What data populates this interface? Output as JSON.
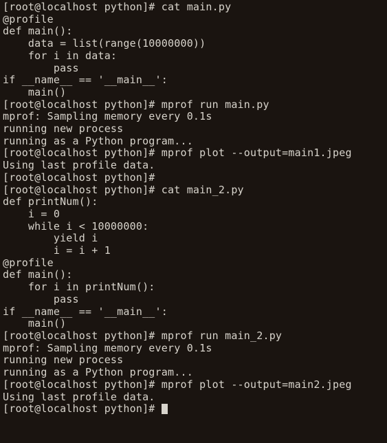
{
  "prompt": "[root@localhost python]# ",
  "lines": [
    {
      "type": "cmd",
      "text": "cat main.py"
    },
    {
      "type": "out",
      "text": "@profile"
    },
    {
      "type": "out",
      "text": "def main():"
    },
    {
      "type": "out",
      "text": "    data = list(range(10000000))"
    },
    {
      "type": "out",
      "text": "    for i in data:"
    },
    {
      "type": "out",
      "text": "        pass"
    },
    {
      "type": "out",
      "text": ""
    },
    {
      "type": "out",
      "text": "if __name__ == '__main__':"
    },
    {
      "type": "out",
      "text": "    main()"
    },
    {
      "type": "cmd",
      "text": "mprof run main.py"
    },
    {
      "type": "out",
      "text": "mprof: Sampling memory every 0.1s"
    },
    {
      "type": "out",
      "text": "running new process"
    },
    {
      "type": "out",
      "text": "running as a Python program..."
    },
    {
      "type": "cmd",
      "text": "mprof plot --output=main1.jpeg"
    },
    {
      "type": "out",
      "text": "Using last profile data."
    },
    {
      "type": "cmd",
      "text": ""
    },
    {
      "type": "cmd",
      "text": "cat main_2.py"
    },
    {
      "type": "out",
      "text": "def printNum():"
    },
    {
      "type": "out",
      "text": "    i = 0"
    },
    {
      "type": "out",
      "text": "    while i < 10000000:"
    },
    {
      "type": "out",
      "text": "        yield i"
    },
    {
      "type": "out",
      "text": "        i = i + 1"
    },
    {
      "type": "out",
      "text": ""
    },
    {
      "type": "out",
      "text": "@profile"
    },
    {
      "type": "out",
      "text": "def main():"
    },
    {
      "type": "out",
      "text": "    for i in printNum():"
    },
    {
      "type": "out",
      "text": "        pass"
    },
    {
      "type": "out",
      "text": ""
    },
    {
      "type": "out",
      "text": "if __name__ == '__main__':"
    },
    {
      "type": "out",
      "text": "    main()"
    },
    {
      "type": "cmd",
      "text": "mprof run main_2.py"
    },
    {
      "type": "out",
      "text": "mprof: Sampling memory every 0.1s"
    },
    {
      "type": "out",
      "text": "running new process"
    },
    {
      "type": "out",
      "text": "running as a Python program..."
    },
    {
      "type": "cmd",
      "text": "mprof plot --output=main2.jpeg"
    },
    {
      "type": "out",
      "text": "Using last profile data."
    },
    {
      "type": "cmd",
      "text": "",
      "cursor": true
    }
  ]
}
